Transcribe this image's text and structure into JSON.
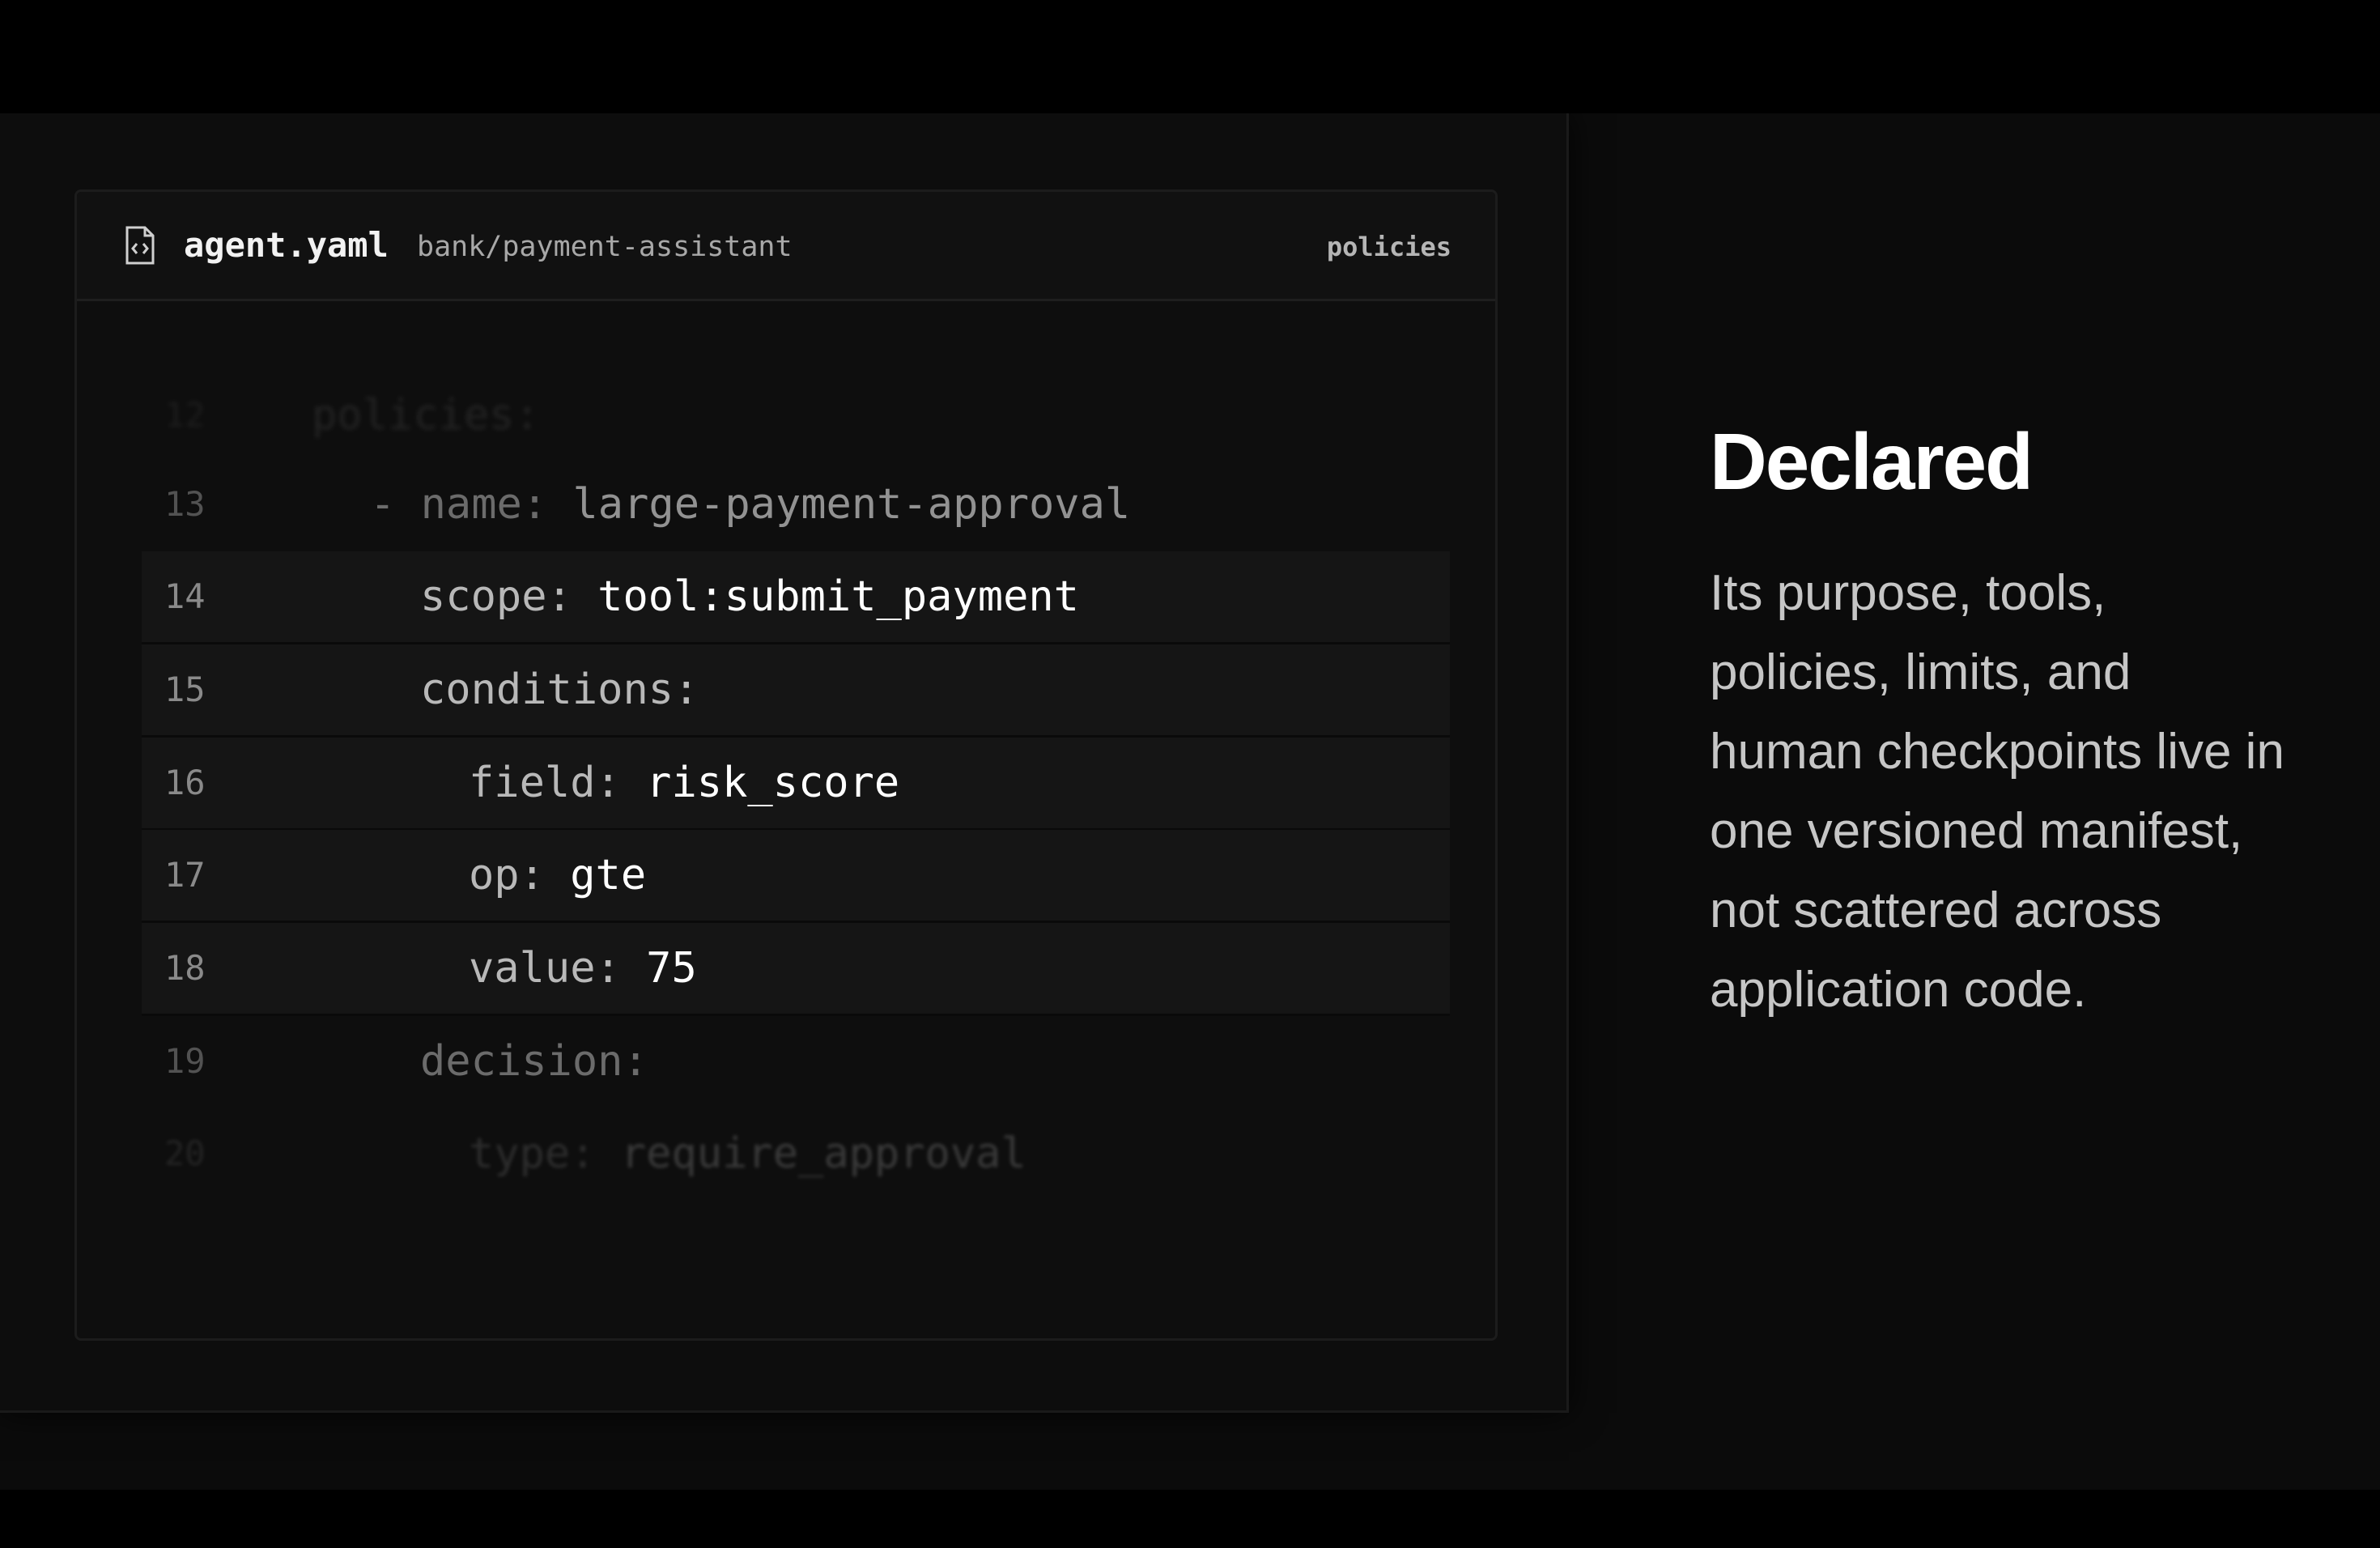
{
  "editor": {
    "file_name": "agent.yaml",
    "file_path": "bank/payment-assistant",
    "section_tag": "policies",
    "file_icon": "code-file-icon",
    "lines": [
      {
        "number": "12",
        "indent": "",
        "key": "policies:",
        "value": ""
      },
      {
        "number": "13",
        "indent": "- ",
        "key": "name:",
        "value": "large-payment-approval"
      },
      {
        "number": "14",
        "indent": "",
        "key": "scope:",
        "value": "tool:submit_payment"
      },
      {
        "number": "15",
        "indent": "",
        "key": "conditions:",
        "value": ""
      },
      {
        "number": "16",
        "indent": "",
        "key": "field:",
        "value": "risk_score"
      },
      {
        "number": "17",
        "indent": "",
        "key": "op:",
        "value": "gte"
      },
      {
        "number": "18",
        "indent": "",
        "key": "value:",
        "value": "75"
      },
      {
        "number": "19",
        "indent": "",
        "key": "decision:",
        "value": ""
      },
      {
        "number": "20",
        "indent": "",
        "key": "type:",
        "value": "require_approval"
      }
    ]
  },
  "aside": {
    "headline": "Declared",
    "description": "Its purpose, tools, policies, limits, and human checkpoints live in one versioned manifest, not scattered across application code."
  }
}
